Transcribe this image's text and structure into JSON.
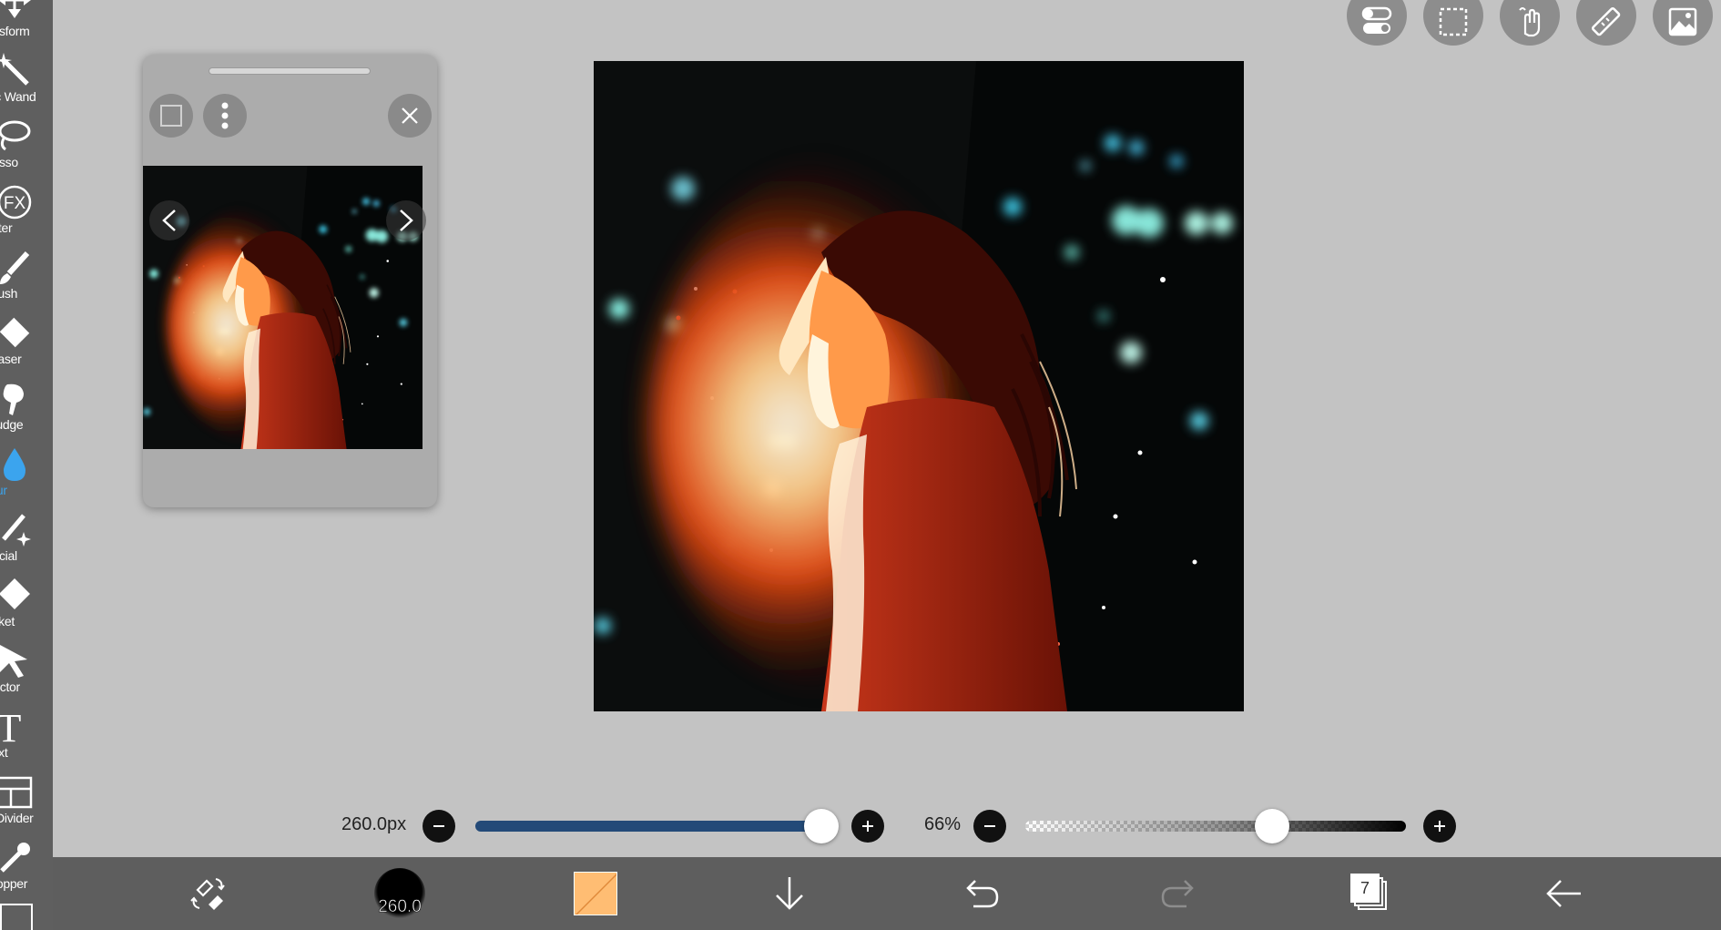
{
  "left_toolbar": {
    "tools": [
      {
        "label": "ansform",
        "icon": "transform-icon"
      },
      {
        "label": "gic Wand",
        "icon": "magic-wand-icon"
      },
      {
        "label": "Lasso",
        "icon": "lasso-icon"
      },
      {
        "label": "Filter",
        "icon": "fx-filter-icon"
      },
      {
        "label": "Brush",
        "icon": "brush-icon"
      },
      {
        "label": "Eraser",
        "icon": "eraser-icon"
      },
      {
        "label": "mudge",
        "icon": "smudge-icon"
      },
      {
        "label": "Blur",
        "icon": "blur-drop-icon",
        "active": true
      },
      {
        "label": "pecial",
        "icon": "special-brush-icon"
      },
      {
        "label": "ucket",
        "icon": "bucket-icon"
      },
      {
        "label": "Vector",
        "icon": "vector-arrow-icon"
      },
      {
        "label": "Text",
        "icon": "text-icon"
      },
      {
        "label": "e Divider",
        "icon": "frame-divider-icon"
      },
      {
        "label": "dropper",
        "icon": "eyedropper-icon"
      }
    ],
    "active_color": "#3ba4ee"
  },
  "top_toolbar": {
    "buttons": [
      "toggle-settings-icon",
      "selection-icon",
      "hand-gesture-icon",
      "ruler-icon",
      "reference-image-icon"
    ]
  },
  "reference_window": {
    "buttons": [
      "square-icon",
      "more-vert-icon",
      "close-icon"
    ],
    "nav": [
      "prev-arrow-icon",
      "next-arrow-icon"
    ]
  },
  "sliders": {
    "size": {
      "label": "260.0px",
      "value_fraction": 0.95,
      "fill_color": "#234a78"
    },
    "opacity": {
      "label": "66%",
      "value_fraction": 0.66
    }
  },
  "bottom_toolbar": {
    "brush_size_label": "260.0",
    "color_swatch": "#ffbd73",
    "layer_count": "7",
    "items": [
      "tool-swap-icon",
      "brush-size-preview",
      "color-swatch",
      "download-arrow-icon",
      "undo-icon",
      "redo-icon",
      "layers-icon",
      "back-arrow-icon"
    ]
  }
}
